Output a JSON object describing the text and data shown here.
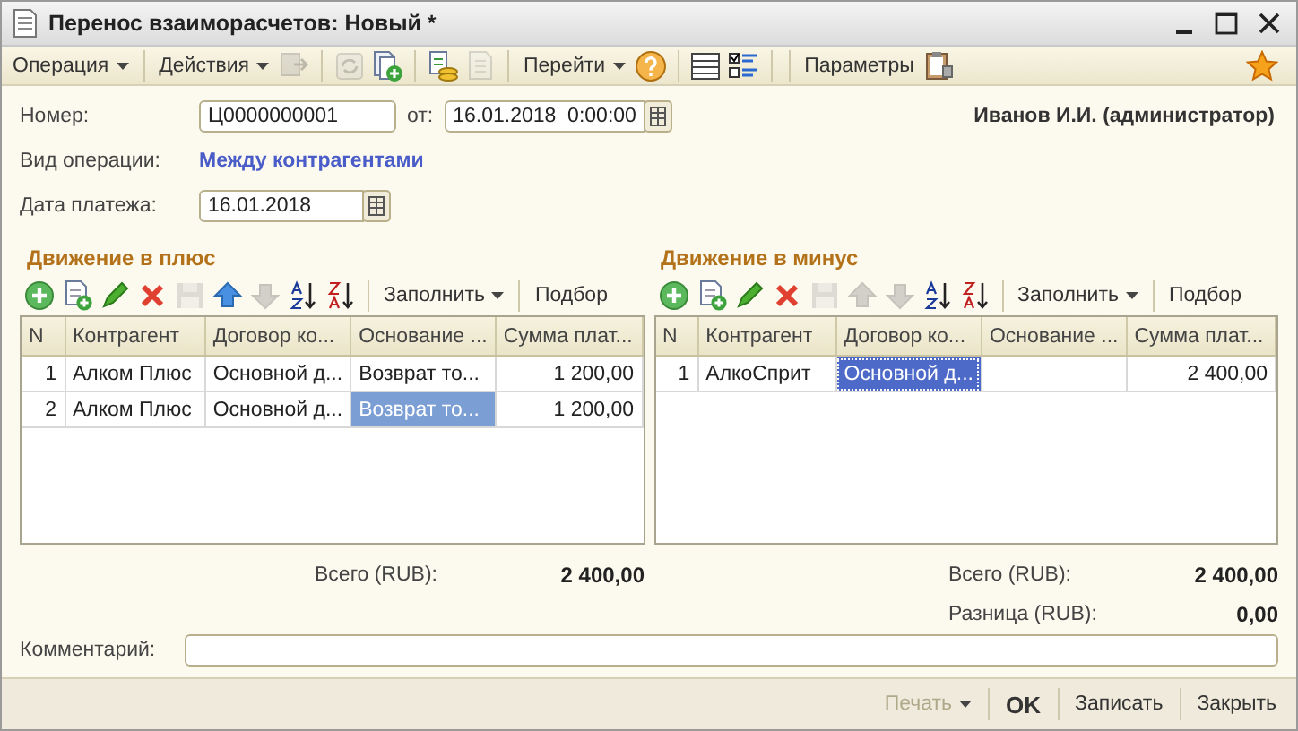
{
  "window": {
    "title": "Перенос взаиморасчетов: Новый *"
  },
  "toolbar": [
    {
      "kind": "menu",
      "label": "Операция"
    },
    {
      "kind": "menu",
      "label": "Действия"
    },
    {
      "kind": "icon",
      "disabled": true
    },
    {
      "kind": "icon",
      "disabled": true
    },
    {
      "kind": "icon",
      "disabled": false
    },
    {
      "kind": "icon",
      "disabled": false
    },
    {
      "kind": "icon",
      "disabled": true
    },
    {
      "kind": "menu",
      "label": "Перейти"
    },
    {
      "kind": "icon",
      "disabled": false
    },
    {
      "kind": "icon",
      "disabled": false
    },
    {
      "kind": "icon",
      "disabled": false
    },
    {
      "kind": "button",
      "label": "Параметры"
    },
    {
      "kind": "icon",
      "disabled": false
    }
  ],
  "header": {
    "number_label": "Номер:",
    "number": "Ц0000000001",
    "date_label": "от:",
    "date": "16.01.2018  0:00:00",
    "user": "Иванов И.И. (администратор)",
    "operation_label": "Вид операции:",
    "operation": "Между контрагентами",
    "payment_date_label": "Дата платежа:",
    "payment_date": "16.01.2018"
  },
  "panels": [
    {
      "title": "Движение в плюс",
      "focused": false,
      "toolbar": [
        {
          "kind": "icon",
          "disabled": false
        },
        {
          "kind": "icon",
          "disabled": false
        },
        {
          "kind": "icon",
          "disabled": false
        },
        {
          "kind": "icon",
          "disabled": false
        },
        {
          "kind": "icon",
          "disabled": true
        },
        {
          "kind": "icon",
          "disabled": false
        },
        {
          "kind": "icon",
          "disabled": true
        },
        {
          "kind": "icon",
          "disabled": false
        },
        {
          "kind": "icon",
          "disabled": false
        },
        {
          "kind": "menu",
          "label": "Заполнить"
        },
        {
          "kind": "button",
          "label": "Подбор"
        }
      ],
      "columns": [
        "N",
        "Контрагент",
        "Договор ко...",
        "Основание ...",
        "Сумма плат..."
      ],
      "rows": [
        {
          "cells": [
            {
              "text": "1",
              "selected": false
            },
            {
              "text": "Алком Плюс",
              "selected": false
            },
            {
              "text": "Основной д...",
              "selected": false
            },
            {
              "text": "Возврат то...",
              "selected": false
            },
            {
              "text": "1 200,00",
              "selected": false
            }
          ]
        },
        {
          "cells": [
            {
              "text": "2",
              "selected": false
            },
            {
              "text": "Алком Плюс",
              "selected": false
            },
            {
              "text": "Основной д...",
              "selected": false
            },
            {
              "text": "Возврат то...",
              "selected": true
            },
            {
              "text": "1 200,00",
              "selected": false
            }
          ]
        }
      ],
      "totals": [
        {
          "label": "Всего (RUB):",
          "value": "2 400,00"
        }
      ]
    },
    {
      "title": "Движение в минус",
      "focused": true,
      "toolbar": [
        {
          "kind": "icon",
          "disabled": false
        },
        {
          "kind": "icon",
          "disabled": false
        },
        {
          "kind": "icon",
          "disabled": false
        },
        {
          "kind": "icon",
          "disabled": false
        },
        {
          "kind": "icon",
          "disabled": true
        },
        {
          "kind": "icon",
          "disabled": true
        },
        {
          "kind": "icon",
          "disabled": true
        },
        {
          "kind": "icon",
          "disabled": false
        },
        {
          "kind": "icon",
          "disabled": false
        },
        {
          "kind": "menu",
          "label": "Заполнить"
        },
        {
          "kind": "button",
          "label": "Подбор"
        }
      ],
      "columns": [
        "N",
        "Контрагент",
        "Договор ко...",
        "Основание ...",
        "Сумма плат..."
      ],
      "rows": [
        {
          "cells": [
            {
              "text": "1",
              "selected": false
            },
            {
              "text": "АлкоСприт",
              "selected": false
            },
            {
              "text": "Основной д...",
              "selected": true
            },
            {
              "selected": false
            },
            {
              "text": "2 400,00",
              "selected": false
            }
          ]
        }
      ],
      "totals": [
        {
          "label": "Всего (RUB):",
          "value": "2 400,00"
        },
        {
          "label": "Разница (RUB):",
          "value": "0,00"
        }
      ]
    }
  ],
  "comment_label": "Комментарий:",
  "footer": [
    {
      "kind": "menu",
      "label": "Печать",
      "disabled": true
    },
    {
      "kind": "button",
      "label": "OK",
      "disabled": false,
      "bold": true
    },
    {
      "kind": "button",
      "label": "Записать",
      "disabled": false,
      "bold": false
    },
    {
      "kind": "button",
      "label": "Закрыть",
      "disabled": false,
      "bold": false
    }
  ]
}
